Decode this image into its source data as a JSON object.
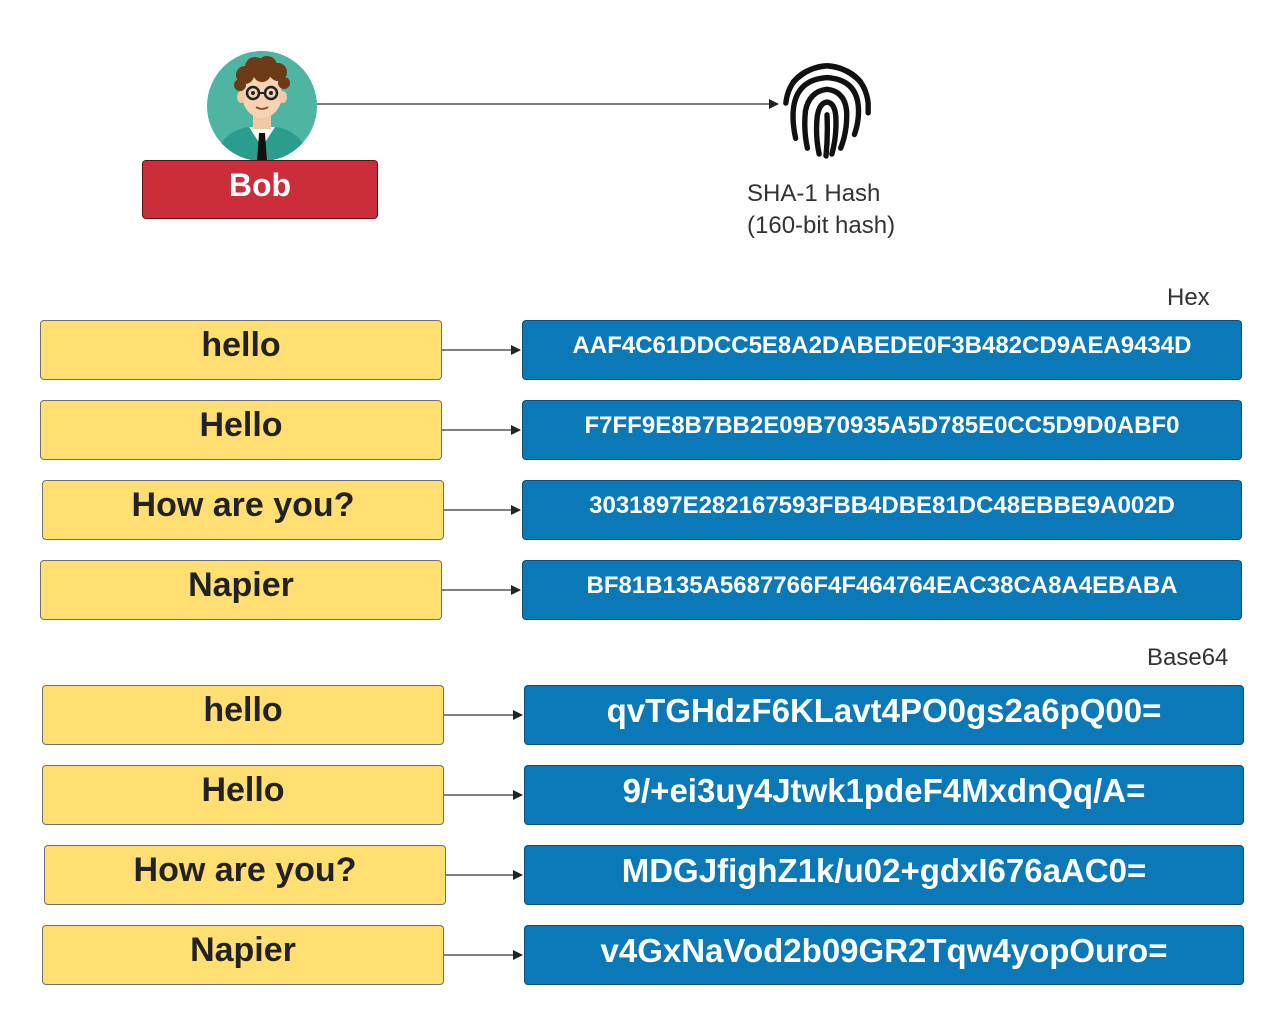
{
  "actor": {
    "name": "Bob",
    "avatar_icon": "person-avatar-icon"
  },
  "hash": {
    "icon": "fingerprint-icon",
    "line1": "SHA-1 Hash",
    "line2": "(160-bit hash)"
  },
  "sections": {
    "hex": {
      "label": "Hex",
      "rows": [
        {
          "input": "hello",
          "output": "AAF4C61DDCC5E8A2DABEDE0F3B482CD9AEA9434D"
        },
        {
          "input": "Hello",
          "output": "F7FF9E8B7BB2E09B70935A5D785E0CC5D9D0ABF0"
        },
        {
          "input": "How are you?",
          "output": "3031897E282167593FBB4DBE81DC48EBBE9A002D"
        },
        {
          "input": "Napier",
          "output": "BF81B135A5687766F4F464764EAC38CA8A4EBABA"
        }
      ]
    },
    "base64": {
      "label": "Base64",
      "rows": [
        {
          "input": "hello",
          "output": "qvTGHdzF6KLavt4PO0gs2a6pQ00="
        },
        {
          "input": "Hello",
          "output": "9/+ei3uy4Jtwk1pdeF4MxdnQq/A="
        },
        {
          "input": "How are you?",
          "output": "MDGJfighZ1k/u02+gdxI676aAC0="
        },
        {
          "input": "Napier",
          "output": "v4GxNaVod2b09GR2Tqw4yopOuro="
        }
      ]
    }
  },
  "colors": {
    "actor_box": "#cc2d3a",
    "message_box": "#ffdf71",
    "hash_box": "#0b78b8"
  }
}
